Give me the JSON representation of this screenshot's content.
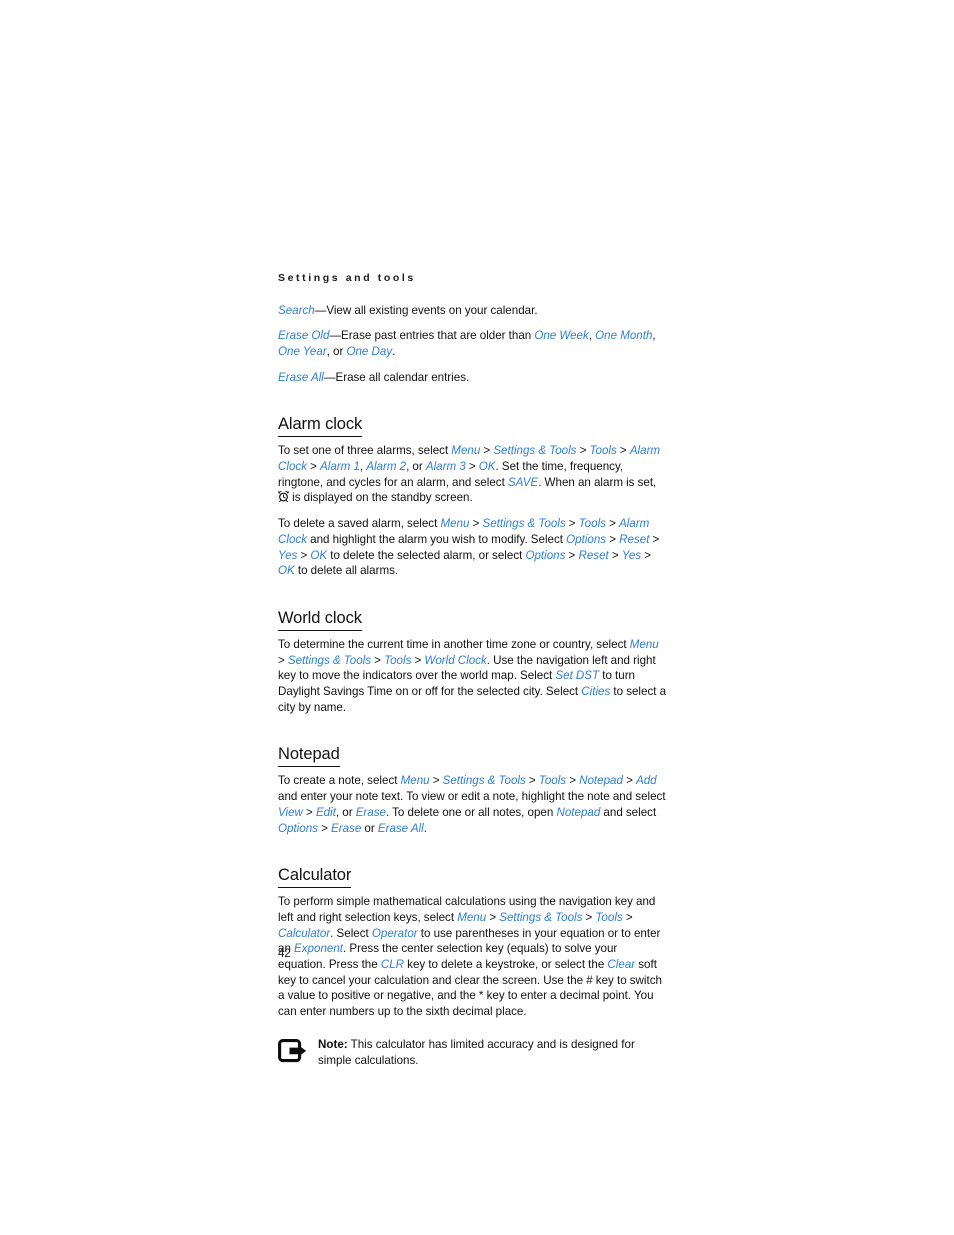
{
  "document": {
    "running_head": "Settings and tools",
    "page_number": "42"
  },
  "colors": {
    "link_blue": "#2f7fd6",
    "body_text": "#121212",
    "heading": "#111111",
    "page_background": "#ffffff"
  },
  "intro_paragraphs": [
    {
      "id": "search",
      "segments": [
        {
          "type": "link",
          "text": "Search"
        },
        {
          "type": "text",
          "text": "—View all existing events on your calendar."
        }
      ]
    },
    {
      "id": "erase-old",
      "segments": [
        {
          "type": "link",
          "text": "Erase Old"
        },
        {
          "type": "text",
          "text": "—Erase past entries that are older than "
        },
        {
          "type": "link",
          "text": "One Week"
        },
        {
          "type": "text",
          "text": ", "
        },
        {
          "type": "link",
          "text": "One Month"
        },
        {
          "type": "text",
          "text": ", "
        },
        {
          "type": "link",
          "text": "One Year"
        },
        {
          "type": "text",
          "text": ", or "
        },
        {
          "type": "link",
          "text": "One Day"
        },
        {
          "type": "text",
          "text": "."
        }
      ]
    },
    {
      "id": "erase-all",
      "segments": [
        {
          "type": "link",
          "text": "Erase All"
        },
        {
          "type": "text",
          "text": "—Erase all calendar entries."
        }
      ]
    }
  ],
  "sections": [
    {
      "id": "alarm-clock",
      "heading": "Alarm clock",
      "paragraphs": [
        {
          "id": "alarm-clock-set",
          "segments": [
            {
              "type": "text",
              "text": "To set one of three alarms, select "
            },
            {
              "type": "link",
              "text": "Menu"
            },
            {
              "type": "sep",
              "text": " > "
            },
            {
              "type": "link",
              "text": "Settings & Tools"
            },
            {
              "type": "sep",
              "text": " > "
            },
            {
              "type": "link",
              "text": "Tools"
            },
            {
              "type": "sep",
              "text": " > "
            },
            {
              "type": "link",
              "text": "Alarm Clock"
            },
            {
              "type": "sep",
              "text": " > "
            },
            {
              "type": "link",
              "text": "Alarm 1"
            },
            {
              "type": "text",
              "text": ", "
            },
            {
              "type": "link",
              "text": "Alarm 2"
            },
            {
              "type": "text",
              "text": ", or "
            },
            {
              "type": "link",
              "text": "Alarm 3"
            },
            {
              "type": "sep",
              "text": " > "
            },
            {
              "type": "link",
              "text": "OK"
            },
            {
              "type": "text",
              "text": ". Set the time, frequency, ringtone, and cycles for an alarm, and select "
            },
            {
              "type": "link",
              "text": "SAVE"
            },
            {
              "type": "text",
              "text": ". When an alarm is set, "
            },
            {
              "type": "icon",
              "text": "alarm-clock-icon"
            },
            {
              "type": "text",
              "text": " is displayed on the standby screen."
            }
          ]
        },
        {
          "id": "alarm-clock-delete",
          "segments": [
            {
              "type": "text",
              "text": "To delete a saved alarm, select "
            },
            {
              "type": "link",
              "text": "Menu"
            },
            {
              "type": "sep",
              "text": " > "
            },
            {
              "type": "link",
              "text": "Settings & Tools"
            },
            {
              "type": "sep",
              "text": " > "
            },
            {
              "type": "link",
              "text": "Tools"
            },
            {
              "type": "sep",
              "text": " > "
            },
            {
              "type": "link",
              "text": "Alarm Clock"
            },
            {
              "type": "text",
              "text": " and highlight the alarm you wish to modify. Select "
            },
            {
              "type": "link",
              "text": "Options"
            },
            {
              "type": "sep",
              "text": " > "
            },
            {
              "type": "link",
              "text": "Reset"
            },
            {
              "type": "sep",
              "text": " > "
            },
            {
              "type": "link",
              "text": "Yes"
            },
            {
              "type": "sep",
              "text": " > "
            },
            {
              "type": "link",
              "text": "OK"
            },
            {
              "type": "text",
              "text": " to delete the selected alarm, or select "
            },
            {
              "type": "link",
              "text": "Options"
            },
            {
              "type": "sep",
              "text": " > "
            },
            {
              "type": "link",
              "text": "Reset"
            },
            {
              "type": "sep",
              "text": " > "
            },
            {
              "type": "link",
              "text": "Yes"
            },
            {
              "type": "sep",
              "text": " > "
            },
            {
              "type": "link",
              "text": "OK"
            },
            {
              "type": "text",
              "text": " to delete all alarms."
            }
          ]
        }
      ]
    },
    {
      "id": "world-clock",
      "heading": "World clock",
      "paragraphs": [
        {
          "id": "world-clock-body",
          "segments": [
            {
              "type": "text",
              "text": "To determine the current time in another time zone or country, select "
            },
            {
              "type": "link",
              "text": "Menu"
            },
            {
              "type": "sep",
              "text": " > "
            },
            {
              "type": "link",
              "text": "Settings & Tools"
            },
            {
              "type": "sep",
              "text": " > "
            },
            {
              "type": "link",
              "text": "Tools"
            },
            {
              "type": "sep",
              "text": " > "
            },
            {
              "type": "link",
              "text": "World Clock"
            },
            {
              "type": "text",
              "text": ". Use the navigation left and right key to move the indicators over the world map. Select "
            },
            {
              "type": "link",
              "text": "Set DST"
            },
            {
              "type": "text",
              "text": " to turn Daylight Savings Time on or off for the selected city. Select "
            },
            {
              "type": "link",
              "text": "Cities"
            },
            {
              "type": "text",
              "text": " to select a city by name."
            }
          ]
        }
      ]
    },
    {
      "id": "notepad",
      "heading": "Notepad",
      "paragraphs": [
        {
          "id": "notepad-body",
          "segments": [
            {
              "type": "text",
              "text": "To create a note, select "
            },
            {
              "type": "link",
              "text": "Menu"
            },
            {
              "type": "sep",
              "text": " > "
            },
            {
              "type": "link",
              "text": "Settings & Tools"
            },
            {
              "type": "sep",
              "text": " > "
            },
            {
              "type": "link",
              "text": "Tools"
            },
            {
              "type": "sep",
              "text": " > "
            },
            {
              "type": "link",
              "text": "Notepad"
            },
            {
              "type": "sep",
              "text": " > "
            },
            {
              "type": "link",
              "text": "Add"
            },
            {
              "type": "text",
              "text": " and enter your note text. To view or edit a note, highlight the note and select "
            },
            {
              "type": "link",
              "text": "View"
            },
            {
              "type": "sep",
              "text": " > "
            },
            {
              "type": "link",
              "text": "Edit"
            },
            {
              "type": "text",
              "text": ", or "
            },
            {
              "type": "link",
              "text": "Erase"
            },
            {
              "type": "text",
              "text": ". To delete one or all notes, open "
            },
            {
              "type": "link",
              "text": "Notepad"
            },
            {
              "type": "text",
              "text": " and select "
            },
            {
              "type": "link",
              "text": "Options"
            },
            {
              "type": "sep",
              "text": " > "
            },
            {
              "type": "link",
              "text": "Erase"
            },
            {
              "type": "text",
              "text": " or "
            },
            {
              "type": "link",
              "text": "Erase All"
            },
            {
              "type": "text",
              "text": "."
            }
          ]
        }
      ]
    },
    {
      "id": "calculator",
      "heading": "Calculator",
      "paragraphs": [
        {
          "id": "calculator-body",
          "segments": [
            {
              "type": "text",
              "text": "To perform simple mathematical calculations using the navigation key and left and right selection keys, select "
            },
            {
              "type": "link",
              "text": "Menu"
            },
            {
              "type": "sep",
              "text": " > "
            },
            {
              "type": "link",
              "text": "Settings & Tools"
            },
            {
              "type": "sep",
              "text": " > "
            },
            {
              "type": "link",
              "text": "Tools"
            },
            {
              "type": "sep",
              "text": " > "
            },
            {
              "type": "link",
              "text": "Calculator"
            },
            {
              "type": "text",
              "text": ". Select "
            },
            {
              "type": "link",
              "text": "Operator"
            },
            {
              "type": "text",
              "text": " to use parentheses in your equation or to enter an "
            },
            {
              "type": "link",
              "text": "Exponent"
            },
            {
              "type": "text",
              "text": ". Press the center selection key (equals) to solve your equation. Press the "
            },
            {
              "type": "link",
              "text": "CLR"
            },
            {
              "type": "text",
              "text": " key to delete a keystroke, or select the "
            },
            {
              "type": "link",
              "text": "Clear"
            },
            {
              "type": "text",
              "text": " soft key to cancel your calculation and clear the screen. Use the # key to switch a value to positive or negative, and the * key to enter a decimal point. You can enter numbers up to the sixth decimal place."
            }
          ]
        }
      ]
    }
  ],
  "note": {
    "icon": "note-arrow-icon",
    "label": "Note:",
    "text": " This calculator has limited accuracy and is designed for simple calculations."
  }
}
